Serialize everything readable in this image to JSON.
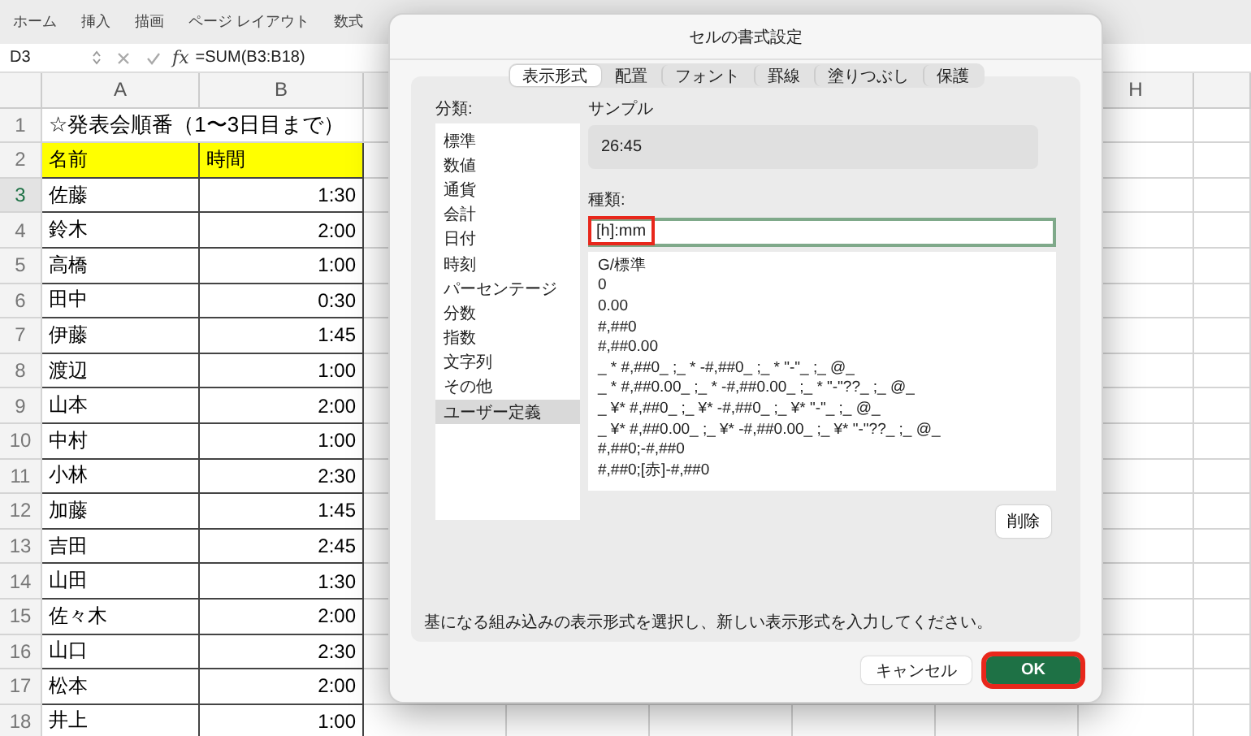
{
  "ribbon": {
    "tabs": [
      {
        "label": "ホーム",
        "selected": false
      },
      {
        "label": "挿入",
        "selected": false
      },
      {
        "label": "描画",
        "selected": false
      },
      {
        "label": "ページ レイアウト",
        "selected": false
      },
      {
        "label": "数式",
        "selected": false
      }
    ]
  },
  "formula_bar": {
    "name_box": "D3",
    "fx": "fx",
    "formula": "=SUM(B3:B18)"
  },
  "sheet": {
    "columns": [
      "A",
      "B",
      "H"
    ],
    "rows": [
      {
        "number": "1",
        "kind": "title",
        "selected": false,
        "cells": [
          "☆発表会順番（1〜3日目まで）"
        ]
      },
      {
        "number": "2",
        "kind": "header",
        "selected": false,
        "cells": [
          "名前",
          "時間"
        ]
      },
      {
        "number": "3",
        "kind": "data",
        "selected": true,
        "cells": [
          "佐藤",
          "1:30"
        ]
      },
      {
        "number": "4",
        "kind": "data",
        "selected": false,
        "cells": [
          "鈴木",
          "2:00"
        ]
      },
      {
        "number": "5",
        "kind": "data",
        "selected": false,
        "cells": [
          "高橋",
          "1:00"
        ]
      },
      {
        "number": "6",
        "kind": "data",
        "selected": false,
        "cells": [
          "田中",
          "0:30"
        ]
      },
      {
        "number": "7",
        "kind": "data",
        "selected": false,
        "cells": [
          "伊藤",
          "1:45"
        ]
      },
      {
        "number": "8",
        "kind": "data",
        "selected": false,
        "cells": [
          "渡辺",
          "1:00"
        ]
      },
      {
        "number": "9",
        "kind": "data",
        "selected": false,
        "cells": [
          "山本",
          "2:00"
        ]
      },
      {
        "number": "10",
        "kind": "data",
        "selected": false,
        "cells": [
          "中村",
          "1:00"
        ]
      },
      {
        "number": "11",
        "kind": "data",
        "selected": false,
        "cells": [
          "小林",
          "2:30"
        ]
      },
      {
        "number": "12",
        "kind": "data",
        "selected": false,
        "cells": [
          "加藤",
          "1:45"
        ]
      },
      {
        "number": "13",
        "kind": "data",
        "selected": false,
        "cells": [
          "吉田",
          "2:45"
        ]
      },
      {
        "number": "14",
        "kind": "data",
        "selected": false,
        "cells": [
          "山田",
          "1:30"
        ]
      },
      {
        "number": "15",
        "kind": "data",
        "selected": false,
        "cells": [
          "佐々木",
          "2:00"
        ]
      },
      {
        "number": "16",
        "kind": "data",
        "selected": false,
        "cells": [
          "山口",
          "2:30"
        ]
      },
      {
        "number": "17",
        "kind": "data",
        "selected": false,
        "cells": [
          "松本",
          "2:00"
        ]
      },
      {
        "number": "18",
        "kind": "data",
        "selected": false,
        "cells": [
          "井上",
          "1:00"
        ]
      }
    ]
  },
  "dialog": {
    "title": "セルの書式設定",
    "tabs": [
      {
        "label": "表示形式",
        "selected": true
      },
      {
        "label": "配置",
        "selected": false
      },
      {
        "label": "フォント",
        "selected": false
      },
      {
        "label": "罫線",
        "selected": false
      },
      {
        "label": "塗りつぶし",
        "selected": false
      },
      {
        "label": "保護",
        "selected": false
      }
    ],
    "category_label": "分類:",
    "categories": [
      {
        "label": "標準",
        "selected": false
      },
      {
        "label": "数値",
        "selected": false
      },
      {
        "label": "通貨",
        "selected": false
      },
      {
        "label": "会計",
        "selected": false
      },
      {
        "label": "日付",
        "selected": false
      },
      {
        "label": "時刻",
        "selected": false
      },
      {
        "label": "パーセンテージ",
        "selected": false
      },
      {
        "label": "分数",
        "selected": false
      },
      {
        "label": "指数",
        "selected": false
      },
      {
        "label": "文字列",
        "selected": false
      },
      {
        "label": "その他",
        "selected": false
      },
      {
        "label": "ユーザー定義",
        "selected": true
      }
    ],
    "sample_label": "サンプル",
    "sample_value": "26:45",
    "type_label": "種類:",
    "type_value": "[h]:mm",
    "type_highlighted": true,
    "formats": [
      "G/標準",
      "0",
      "0.00",
      "#,##0",
      "#,##0.00",
      "_ * #,##0_ ;_ * -#,##0_ ;_ * \"-\"_ ;_ @_",
      "_ * #,##0.00_ ;_ * -#,##0.00_ ;_ * \"-\"??_ ;_ @_",
      "_ ¥* #,##0_ ;_ ¥* -#,##0_ ;_ ¥* \"-\"_ ;_ @_",
      "_ ¥* #,##0.00_ ;_ ¥* -#,##0.00_ ;_ ¥* \"-\"??_ ;_ @_",
      "#,##0;-#,##0",
      "#,##0;[赤]-#,##0"
    ],
    "delete_button": "削除",
    "description": "基になる組み込みの表示形式を選択し、新しい表示形式を入力してください。",
    "buttons": [
      {
        "label": "キャンセル",
        "kind": "cancel",
        "highlighted": false
      },
      {
        "label": "OK",
        "kind": "ok",
        "highlighted": true
      }
    ]
  }
}
